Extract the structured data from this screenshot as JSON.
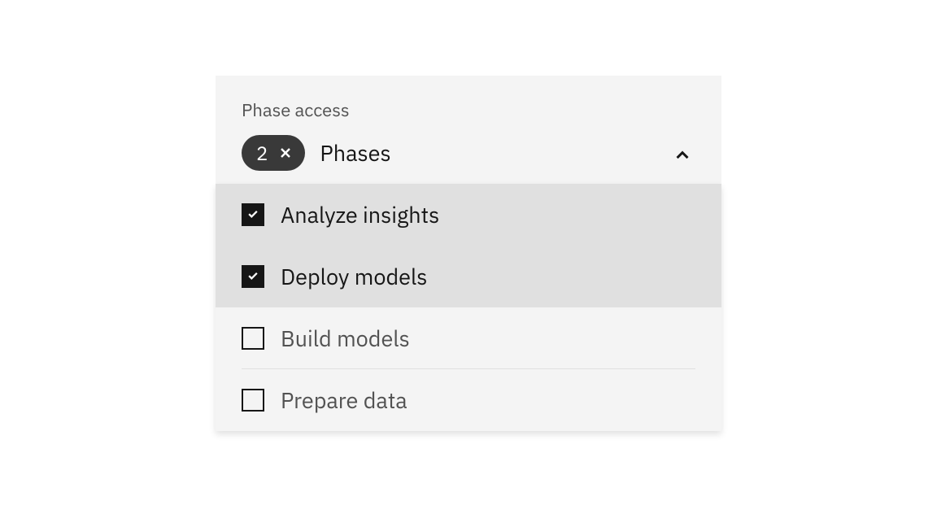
{
  "multiselect": {
    "label": "Phase access",
    "placeholder": "Phases",
    "selected_count": "2",
    "expanded": true,
    "options": [
      {
        "label": "Analyze insights",
        "checked": true
      },
      {
        "label": "Deploy models",
        "checked": true
      },
      {
        "label": "Build models",
        "checked": false
      },
      {
        "label": "Prepare data",
        "checked": false
      }
    ]
  }
}
